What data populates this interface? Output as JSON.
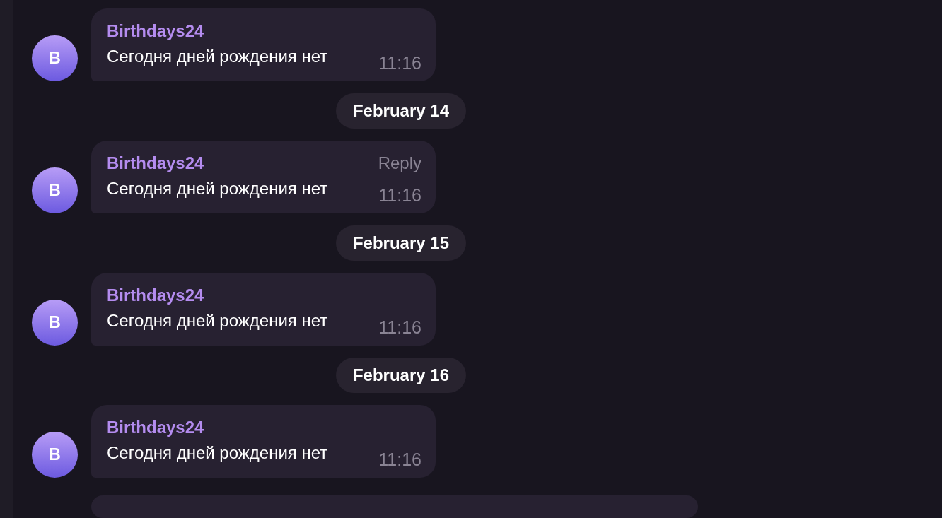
{
  "feed": [
    {
      "kind": "message",
      "avatar": "B",
      "sender": "Birthdays24",
      "text": "Сегодня дней рождения нет",
      "time": "11:16"
    },
    {
      "kind": "date",
      "label": "February 14"
    },
    {
      "kind": "message",
      "avatar": "B",
      "sender": "Birthdays24",
      "text": "Сегодня дней рождения нет",
      "time": "11:16",
      "action": "Reply"
    },
    {
      "kind": "date",
      "label": "February 15"
    },
    {
      "kind": "message",
      "avatar": "B",
      "sender": "Birthdays24",
      "text": "Сегодня дней рождения нет",
      "time": "11:16"
    },
    {
      "kind": "date",
      "label": "February 16"
    },
    {
      "kind": "message",
      "avatar": "B",
      "sender": "Birthdays24",
      "text": "Сегодня дней рождения нет",
      "time": "11:16"
    },
    {
      "kind": "partial"
    }
  ]
}
